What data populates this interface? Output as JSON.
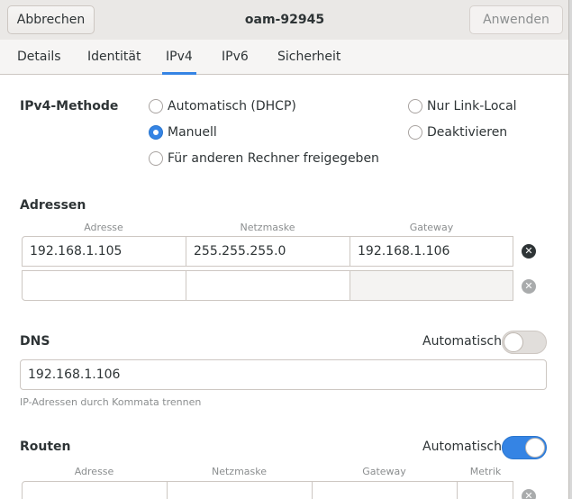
{
  "header": {
    "cancel_label": "Abbrechen",
    "title": "oam-92945",
    "apply_label": "Anwenden"
  },
  "tabs": [
    {
      "label": "Details"
    },
    {
      "label": "Identität"
    },
    {
      "label": "IPv4",
      "active": true
    },
    {
      "label": "IPv6"
    },
    {
      "label": "Sicherheit"
    }
  ],
  "method": {
    "title": "IPv4-Methode",
    "options": [
      {
        "label": "Automatisch (DHCP)",
        "checked": false
      },
      {
        "label": "Manuell",
        "checked": true
      },
      {
        "label": "Für anderen Rechner freigegeben",
        "checked": false
      },
      {
        "label": "Nur Link-Local",
        "checked": false
      },
      {
        "label": "Deaktivieren",
        "checked": false
      }
    ]
  },
  "addresses": {
    "title": "Adressen",
    "columns": [
      "Adresse",
      "Netzmaske",
      "Gateway"
    ],
    "rows": [
      {
        "address": "192.168.1.105",
        "netmask": "255.255.255.0",
        "gateway": "192.168.1.106"
      },
      {
        "address": "",
        "netmask": "",
        "gateway": ""
      }
    ]
  },
  "dns": {
    "title": "DNS",
    "auto_label": "Automatisch",
    "auto_enabled": false,
    "value": "192.168.1.106",
    "hint": "IP-Adressen durch Kommata trennen"
  },
  "routes": {
    "title": "Routen",
    "auto_label": "Automatisch",
    "auto_enabled": true,
    "columns": [
      "Adresse",
      "Netzmaske",
      "Gateway",
      "Metrik"
    ]
  },
  "colors": {
    "accent": "#3584e4",
    "header_bg": "#eae8e6"
  }
}
